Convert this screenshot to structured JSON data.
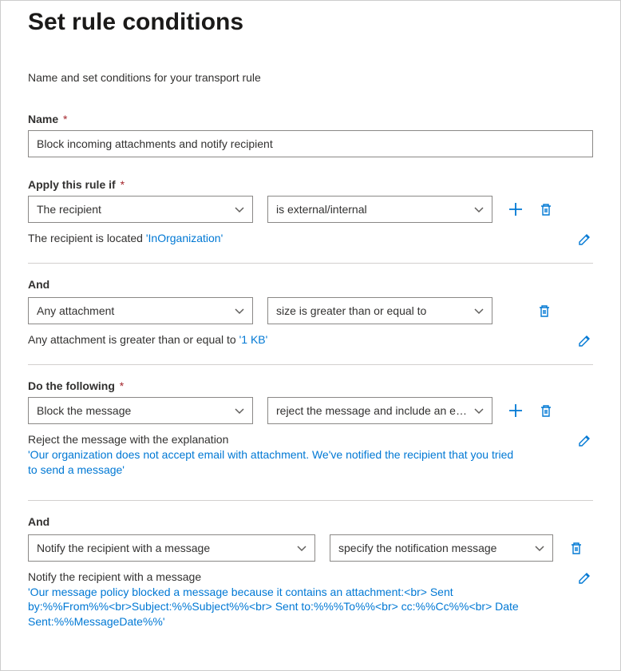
{
  "title": "Set rule conditions",
  "subtitle": "Name and set conditions for your transport rule",
  "name_field": {
    "label": "Name",
    "value": "Block incoming attachments and notify recipient"
  },
  "apply_if": {
    "label": "Apply this rule if",
    "dd1": "The recipient",
    "dd2": "is external/internal",
    "summary_prefix": "The recipient is located ",
    "summary_value": "'InOrganization'"
  },
  "and1": {
    "label": "And",
    "dd1": "Any attachment",
    "dd2": "size is greater than or equal to",
    "summary_prefix": "Any attachment is greater than or equal to ",
    "summary_value": "'1 KB'"
  },
  "do_following": {
    "label": "Do the following",
    "dd1": "Block the message",
    "dd2": "reject the message and include an exp...",
    "summary_line1": "Reject the message with the explanation",
    "summary_value": "'Our organization does not accept email with attachment. We've notified the recipient that you tried to send a message'"
  },
  "and2": {
    "label": "And",
    "dd1": "Notify the recipient with a message",
    "dd2": "specify the notification message",
    "summary_line1": "Notify the recipient with a message",
    "summary_value": "'Our message policy blocked a message because it contains an attachment:<br> Sent by:%%From%%<br>Subject:%%Subject%%<br> Sent to:%%%To%%<br> cc:%%Cc%%<br> Date Sent:%%MessageDate%%'"
  }
}
